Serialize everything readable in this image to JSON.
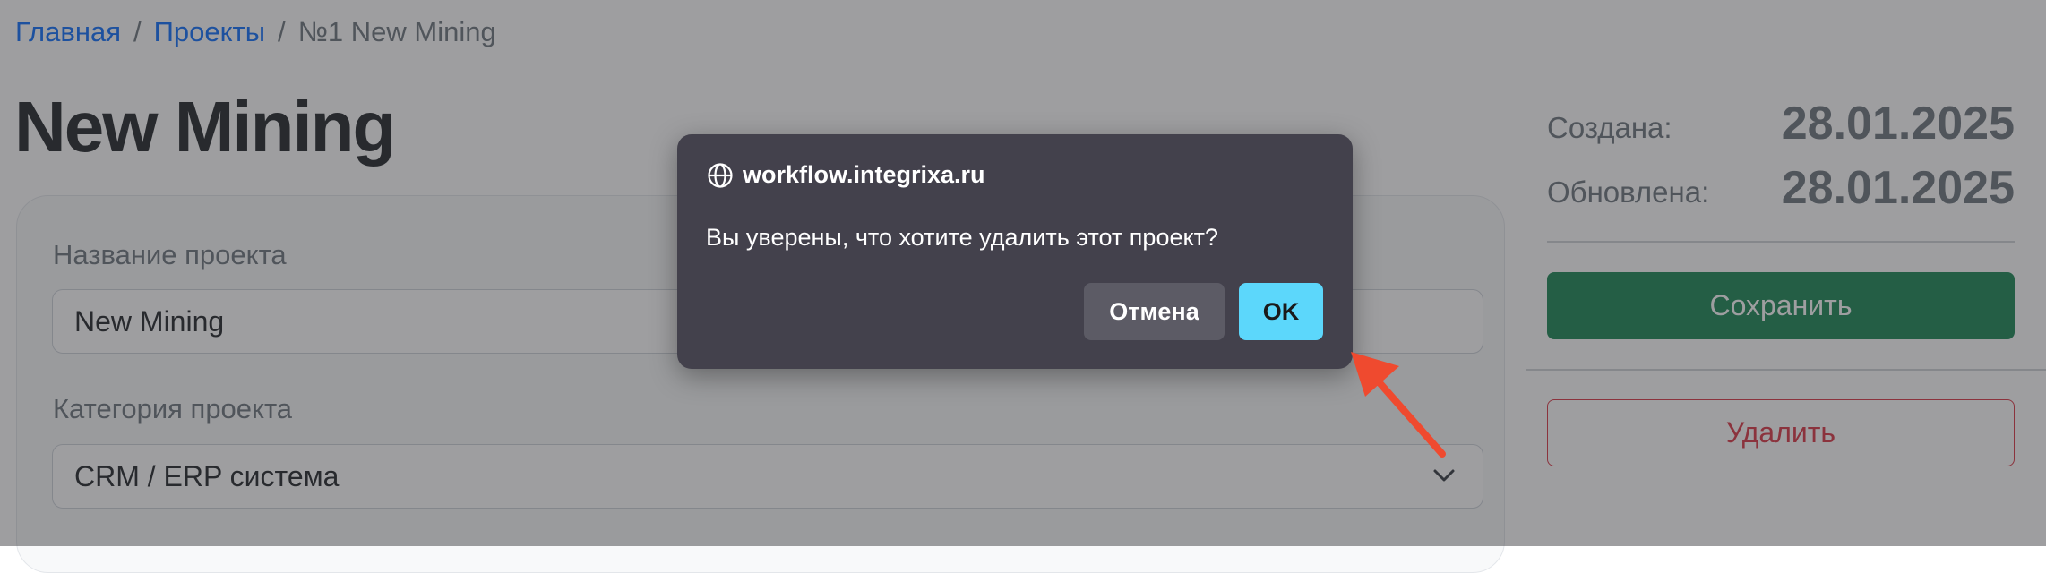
{
  "breadcrumb": {
    "home": "Главная",
    "projects": "Проекты",
    "separator": "/",
    "current": "№1 New Mining"
  },
  "page": {
    "title": "New Mining"
  },
  "form": {
    "name_label": "Название проекта",
    "name_value": "New Mining",
    "category_label": "Категория проекта",
    "category_value": "CRM / ERP система"
  },
  "meta": {
    "created_label": "Создана:",
    "created_value": "28.01.2025",
    "updated_label": "Обновлена:",
    "updated_value": "28.01.2025"
  },
  "actions": {
    "save_label": "Сохранить",
    "delete_label": "Удалить"
  },
  "dialog": {
    "origin": "workflow.integrixa.ru",
    "origin_icon": "globe-icon",
    "message": "Вы уверены, что хотите удалить этот проект?",
    "cancel_label": "Отмена",
    "ok_label": "OK"
  },
  "colors": {
    "link": "#0d6efd",
    "save": "#198754",
    "delete": "#dc3545",
    "dialog_bg": "#43414c",
    "ok_button": "#5cd7fb",
    "annotation_arrow": "#ef4a2f"
  }
}
